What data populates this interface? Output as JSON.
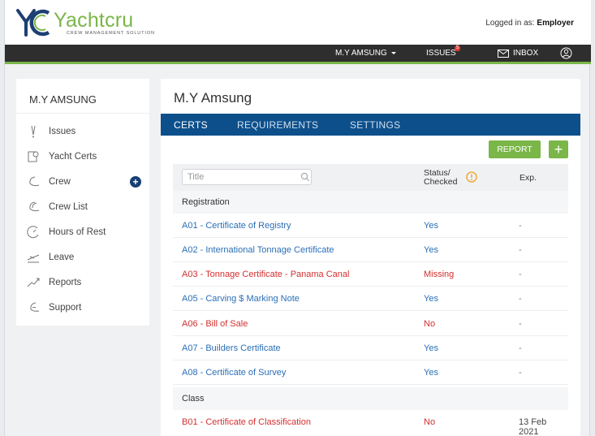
{
  "brand": {
    "name": "Yachtcru",
    "tagline": "CREW MANAGEMENT SOLUTION",
    "accent": "#7ab648",
    "navy": "#0d4f8b",
    "logo_mark": "YC"
  },
  "header": {
    "logged_label": "Logged in as:",
    "role": "Employer"
  },
  "nav": {
    "vessel": "M.Y AMSUNG",
    "issues": "ISSUES",
    "issues_count": "5",
    "inbox": "INBOX",
    "account_icon": "user-circle-icon"
  },
  "sidebar": {
    "title": "M.Y AMSUNG",
    "items": [
      {
        "label": "Issues",
        "icon": "issues-icon"
      },
      {
        "label": "Yacht Certs",
        "icon": "certs-icon"
      },
      {
        "label": "Crew",
        "icon": "crew-icon"
      },
      {
        "label": "Crew List",
        "icon": "crew-list-icon"
      },
      {
        "label": "Hours of Rest",
        "icon": "clock-icon"
      },
      {
        "label": "Leave",
        "icon": "plane-icon"
      },
      {
        "label": "Reports",
        "icon": "chart-icon"
      },
      {
        "label": "Support",
        "icon": "support-icon"
      }
    ]
  },
  "main": {
    "title": "M.Y Amsung",
    "tabs": [
      {
        "label": "CERTS"
      },
      {
        "label": "REQUIREMENTS"
      },
      {
        "label": "SETTINGS"
      }
    ],
    "report_label": "REPORT",
    "add_label": "+",
    "search_placeholder": "Title",
    "col_status_1": "Status/",
    "col_status_2": "Checked",
    "col_exp": "Exp.",
    "groups": [
      {
        "label": "Registration"
      },
      {
        "label": "Class"
      }
    ],
    "rows": [
      {
        "title": "A01 - Certificate of Registry",
        "status": "Yes",
        "exp": "-"
      },
      {
        "title": "A02 - International Tonnage Certificate",
        "status": "Yes",
        "exp": "-"
      },
      {
        "title": "A03 - Tonnage Certificate - Panama Canal",
        "status": "Missing",
        "exp": "-"
      },
      {
        "title": "A05 - Carving $ Marking Note",
        "status": "Yes",
        "exp": "-"
      },
      {
        "title": "A06 - Bill of Sale",
        "status": "No",
        "exp": "-"
      },
      {
        "title": "A07 - Builders Certificate",
        "status": "Yes",
        "exp": "-"
      },
      {
        "title": "A08 - Certificate of Survey",
        "status": "Yes",
        "exp": "-"
      },
      {
        "title": "B01 - Certificate of Classification",
        "status": "No",
        "exp": "13 Feb 2021"
      }
    ]
  }
}
